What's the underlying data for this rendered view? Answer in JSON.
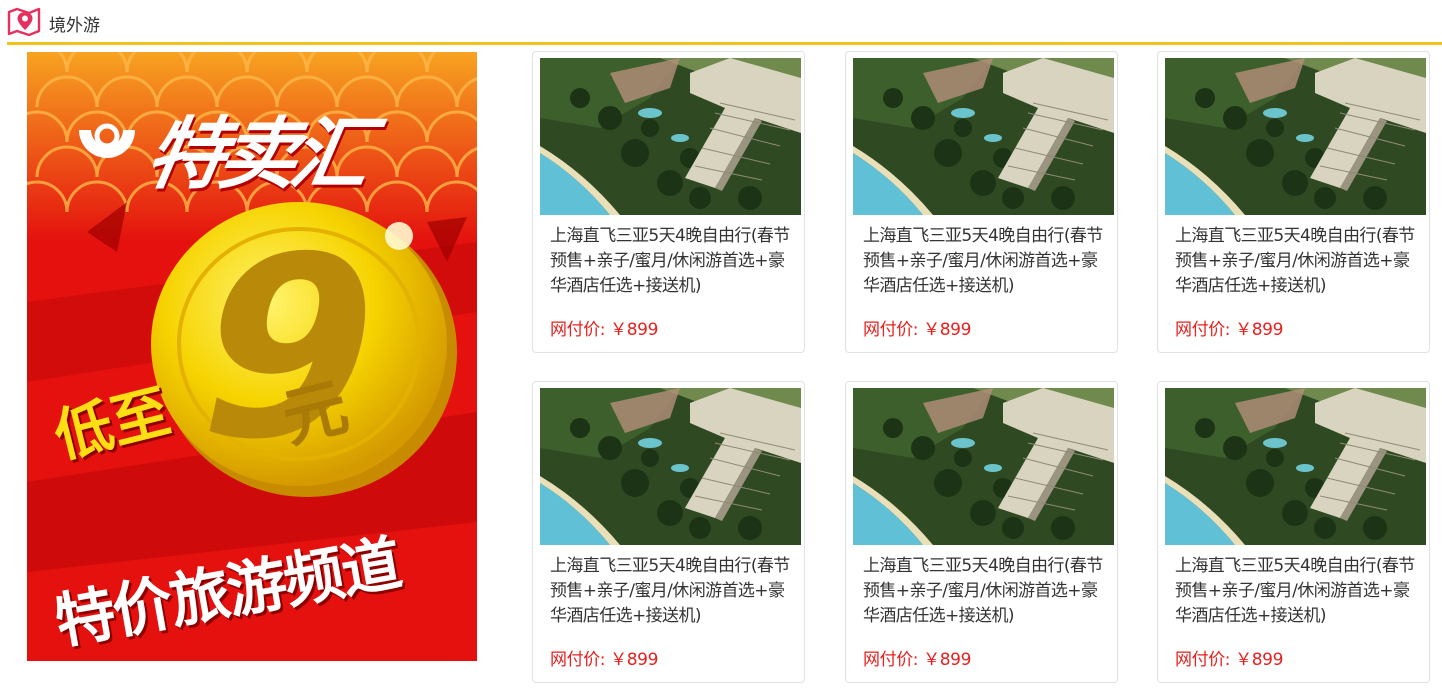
{
  "header": {
    "title": "境外游",
    "icon": "map-location-icon",
    "accent": "#f2c21a",
    "icon_color": "#e4315f"
  },
  "promo": {
    "brand": "特卖汇",
    "low_prefix": "低至",
    "amount": "9",
    "unit": "元",
    "channel": "特价旅游频道",
    "bg_color": "#e4110e",
    "coin_color": "#f5d300"
  },
  "products": [
    {
      "name": "上海直飞三亚5天4晚自由行(春节预售+亲子/蜜月/休闲游首选+豪华酒店任选+接送机)",
      "price_label": "网付价:",
      "price": "￥899"
    },
    {
      "name": "上海直飞三亚5天4晚自由行(春节预售+亲子/蜜月/休闲游首选+豪华酒店任选+接送机)",
      "price_label": "网付价:",
      "price": "￥899"
    },
    {
      "name": "上海直飞三亚5天4晚自由行(春节预售+亲子/蜜月/休闲游首选+豪华酒店任选+接送机)",
      "price_label": "网付价:",
      "price": "￥899"
    },
    {
      "name": "上海直飞三亚5天4晚自由行(春节预售+亲子/蜜月/休闲游首选+豪华酒店任选+接送机)",
      "price_label": "网付价:",
      "price": "￥899"
    },
    {
      "name": "上海直飞三亚5天4晚自由行(春节预售+亲子/蜜月/休闲游首选+豪华酒店任选+接送机)",
      "price_label": "网付价:",
      "price": "￥899"
    },
    {
      "name": "上海直飞三亚5天4晚自由行(春节预售+亲子/蜜月/休闲游首选+豪华酒店任选+接送机)",
      "price_label": "网付价:",
      "price": "￥899"
    }
  ],
  "colors": {
    "price": "#e8201e",
    "card_border": "#e2e2e2"
  }
}
